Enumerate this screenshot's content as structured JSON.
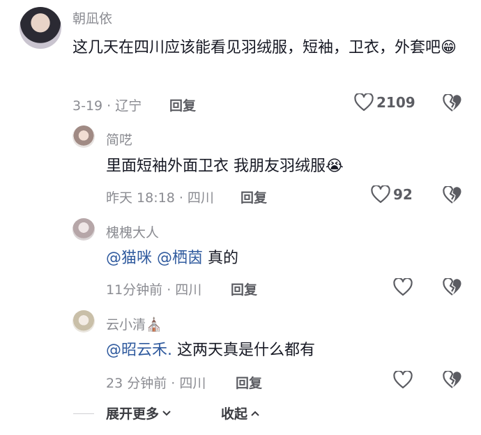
{
  "comments": [
    {
      "name": "朝凪依",
      "text": "这几天在四川应该能看见羽绒服，短袖，卫衣，外套吧",
      "emoji": "😁",
      "meta": "3-19 · 辽宁",
      "reply_label": "回复",
      "likes": "2109"
    },
    {
      "name": "简呓",
      "text": "里面短袖外面卫衣 我朋友羽绒服",
      "emoji": "😭",
      "meta": "昨天 18:18 · 四川",
      "reply_label": "回复",
      "likes": "92"
    },
    {
      "name": "槐槐大人",
      "mention1": "@猫咪",
      "mention2": "@栖茵",
      "text": "真的",
      "meta": "11分钟前 · 四川",
      "reply_label": "回复"
    },
    {
      "name": "云小清",
      "name_emoji": "⛪",
      "mention1": "@昭云禾.",
      "text": "这两天真是什么都有",
      "meta": "23 分钟前 · 四川",
      "reply_label": "回复"
    }
  ],
  "footer": {
    "expand_label": "展开更多",
    "collapse_label": "收起"
  },
  "icons": {
    "like": "heart-outline-icon",
    "dislike": "broken-heart-icon",
    "expand": "chevron-down-icon",
    "collapse": "chevron-up-icon"
  },
  "colors": {
    "mention": "#2f5a9e",
    "meta": "#8a8b91",
    "text": "#161823"
  }
}
